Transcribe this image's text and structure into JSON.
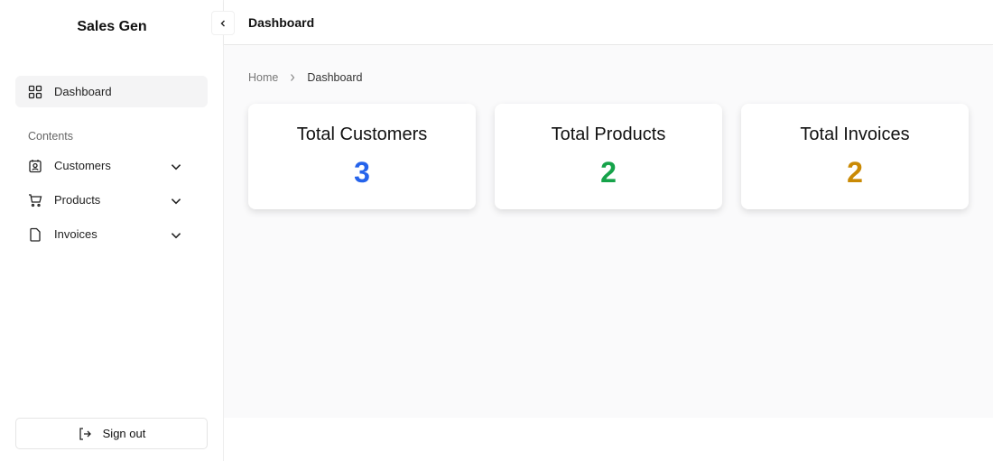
{
  "app": {
    "name": "Sales Gen"
  },
  "header": {
    "title": "Dashboard"
  },
  "sidebar": {
    "dashboard": "Dashboard",
    "section": "Contents",
    "items": [
      {
        "label": "Customers"
      },
      {
        "label": "Products"
      },
      {
        "label": "Invoices"
      }
    ],
    "signout": "Sign out"
  },
  "breadcrumb": {
    "home": "Home",
    "current": "Dashboard"
  },
  "cards": [
    {
      "title": "Total Customers",
      "value": "3",
      "color": "#2563eb"
    },
    {
      "title": "Total Products",
      "value": "2",
      "color": "#16a34a"
    },
    {
      "title": "Total Invoices",
      "value": "2",
      "color": "#ca8a04"
    }
  ]
}
